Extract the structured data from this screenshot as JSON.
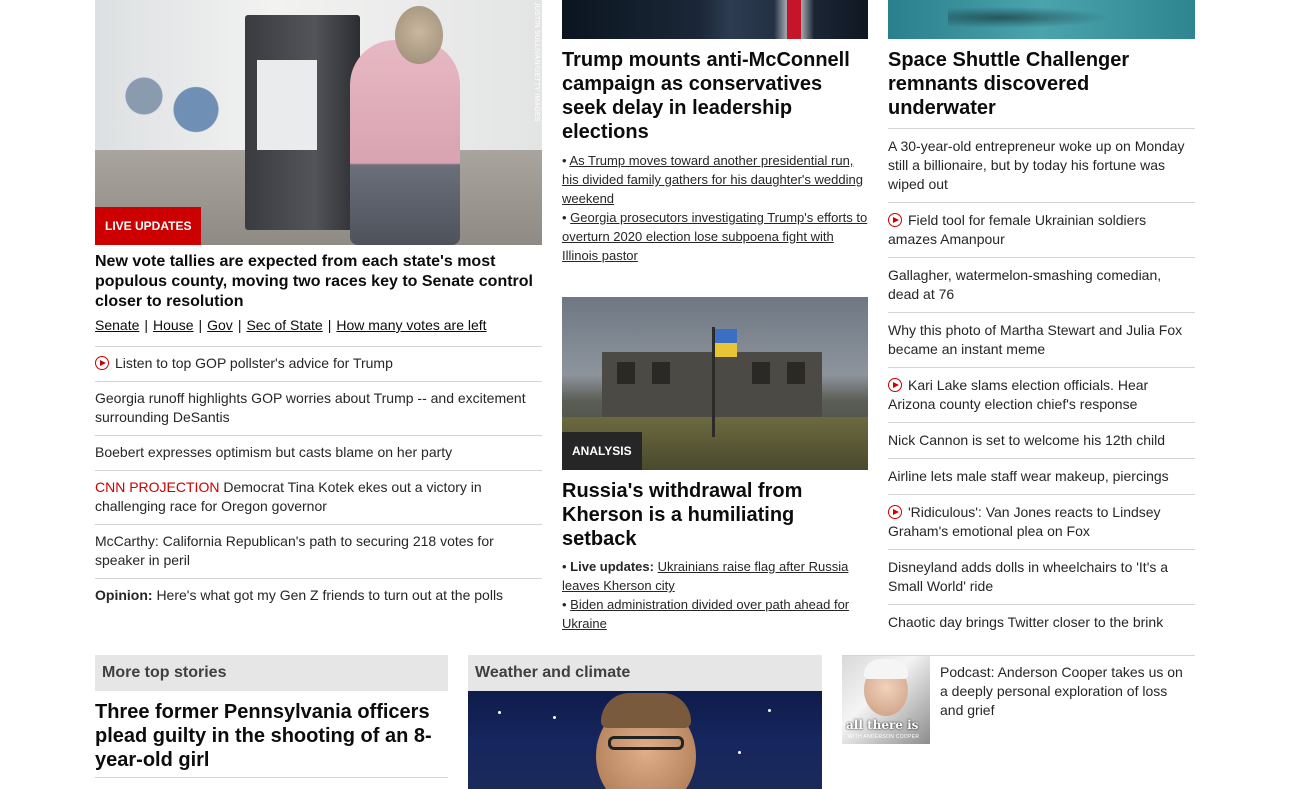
{
  "hero": {
    "credit": "JUSTIN SULLIVAN/GETTY IMAGES",
    "badge": "LIVE UPDATES",
    "title": "New vote tallies are expected from each state's most populous county, moving two races key to Senate control closer to resolution",
    "subnav": [
      "Senate",
      "House",
      "Gov",
      "Sec of State",
      "How many votes are left"
    ]
  },
  "col1_list": [
    {
      "video": true,
      "prefix": "",
      "text": "Listen to top GOP pollster's advice for Trump"
    },
    {
      "video": false,
      "prefix": "",
      "text": "Georgia runoff highlights GOP worries about Trump -- and excitement surrounding DeSantis"
    },
    {
      "video": false,
      "prefix": "",
      "text": "Boebert expresses optimism but casts blame on her party"
    },
    {
      "video": false,
      "prefix": "CNN PROJECTION",
      "text": "Democrat Tina Kotek ekes out a victory in challenging race for Oregon governor"
    },
    {
      "video": false,
      "prefix": "",
      "text": "McCarthy: California Republican's path to securing 218 votes for speaker in peril"
    },
    {
      "video": false,
      "prefix": "Opinion:",
      "text": "Here's what got my Gen Z friends to turn out at the polls"
    }
  ],
  "col2": {
    "title": "Trump mounts anti-McConnell campaign as conservatives seek delay in leadership elections",
    "bullets": [
      "As Trump moves toward another presidential run, his divided family gathers for his daughter's wedding weekend",
      "Georgia prosecutors investigating Trump's efforts to overturn 2020 election lose subpoena fight with Illinois pastor"
    ],
    "badge": "ANALYSIS",
    "title2": "Russia's withdrawal from Kherson is a humiliating setback",
    "bullets2_prefix": "Live updates:",
    "bullets2": [
      "Ukrainians raise flag after Russia leaves Kherson city",
      "Biden administration divided over path ahead for Ukraine"
    ]
  },
  "col3": {
    "title": "Space Shuttle Challenger remnants discovered underwater",
    "list": [
      {
        "video": false,
        "text": "A 30-year-old entrepreneur woke up on Monday still a billionaire, but by today his fortune was wiped out"
      },
      {
        "video": true,
        "text": "Field tool for female Ukrainian soldiers amazes Amanpour"
      },
      {
        "video": false,
        "text": "Gallagher, watermelon-smashing comedian, dead at 76"
      },
      {
        "video": false,
        "text": "Why this photo of Martha Stewart and Julia Fox became an instant meme"
      },
      {
        "video": true,
        "text": "Kari Lake slams election officials. Hear Arizona county election chief's response"
      },
      {
        "video": false,
        "text": "Nick Cannon is set to welcome his 12th child"
      },
      {
        "video": false,
        "text": "Airline lets male staff wear makeup, piercings"
      },
      {
        "video": true,
        "text": "'Ridiculous': Van Jones reacts to Lindsey Graham's emotional plea on Fox"
      },
      {
        "video": false,
        "text": "Disneyland adds dolls in wheelchairs to 'It's a Small World' ride"
      },
      {
        "video": false,
        "text": "Chaotic day brings Twitter closer to the brink"
      }
    ]
  },
  "bottom": {
    "more_head": "More top stories",
    "more_title": "Three former Pennsylvania officers plead guilty in the shooting of an 8-year-old girl",
    "weather_head": "Weather and climate",
    "podcast_text": "Podcast: Anderson Cooper takes us on a deeply personal exploration of loss and grief",
    "podcast_art": "all there is",
    "podcast_art_sub": "WITH ANDERSON COOPER"
  },
  "colors": {
    "accent": "#cc0000",
    "badge_dark": "#262626",
    "section_bg": "#e6e6e6"
  }
}
